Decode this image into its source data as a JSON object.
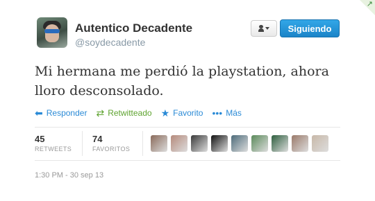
{
  "user": {
    "display_name": "Autentico Decadente",
    "handle": "@soydecadente"
  },
  "header": {
    "follow_label": "Siguiendo"
  },
  "tweet": {
    "text": "Mi hermana me perdió la playstation, ahora lloro desconsolado."
  },
  "actions": [
    {
      "label": "Responder",
      "icon": "reply-icon"
    },
    {
      "label": "Retwitteado",
      "icon": "retweet-icon"
    },
    {
      "label": "Favorito",
      "icon": "star-icon"
    },
    {
      "label": "Más",
      "icon": "more-icon"
    }
  ],
  "stats": {
    "retweets": {
      "count": "45",
      "label": "RETWEETS"
    },
    "favorites": {
      "count": "74",
      "label": "FAVORITOS"
    }
  },
  "favoriters": [
    {
      "color": "#8a6a5a"
    },
    {
      "color": "#b58a7c"
    },
    {
      "color": "#3a3a3a"
    },
    {
      "color": "#111111"
    },
    {
      "color": "#4d6b7a"
    },
    {
      "color": "#5a8a5a"
    },
    {
      "color": "#2e5e3e"
    },
    {
      "color": "#9a7a6a"
    },
    {
      "color": "#c8b8a8"
    }
  ],
  "timestamp": "1:30 PM - 30 sep 13",
  "colors": {
    "accent": "#2a8ad6",
    "retweet_green": "#5ea32f",
    "follow_blue": "#1b84c8"
  }
}
